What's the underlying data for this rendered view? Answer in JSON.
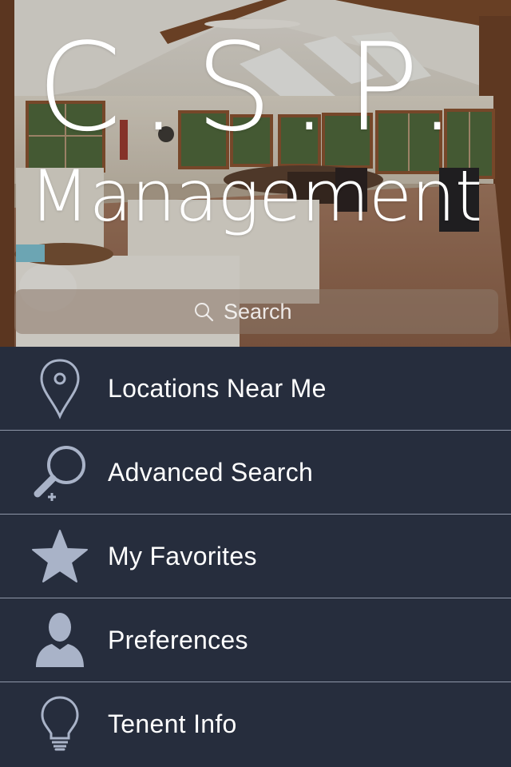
{
  "brand": {
    "initials": "C.S.P.",
    "name": "Management"
  },
  "search": {
    "placeholder": "Search",
    "icon": "search-icon"
  },
  "colors": {
    "menu_background": "#262d3d",
    "icon_color": "#a9b3c8",
    "divider": "#8e96a8",
    "text": "#ffffff"
  },
  "menu": {
    "items": [
      {
        "label": "Locations Near Me",
        "icon": "map-pin-icon"
      },
      {
        "label": "Advanced Search",
        "icon": "magnifier-plus-icon"
      },
      {
        "label": "My Favorites",
        "icon": "star-icon"
      },
      {
        "label": "Preferences",
        "icon": "person-icon"
      },
      {
        "label": "Tenent Info",
        "icon": "lightbulb-icon"
      }
    ]
  }
}
